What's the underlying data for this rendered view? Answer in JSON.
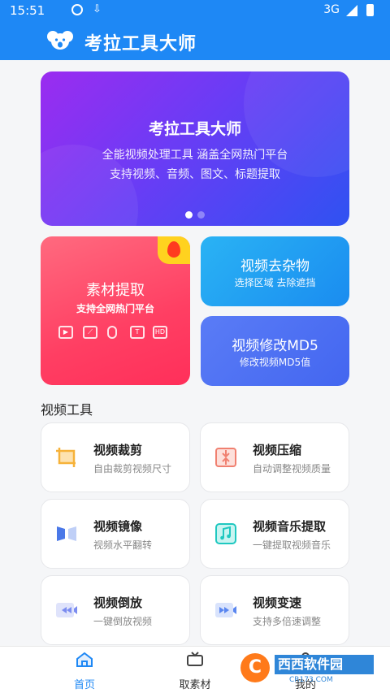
{
  "status_bar": {
    "time": "15:51",
    "network": "3G"
  },
  "app_bar": {
    "title": "考拉工具大师",
    "logo_icon": "koala-icon"
  },
  "banner": {
    "title": "考拉工具大师",
    "subtitle_1": "全能视频处理工具 涵盖全网热门平台",
    "subtitle_2": "支持视频、音频、图文、标题提取"
  },
  "features": {
    "material": {
      "title": "素材提取",
      "subtitle": "支持全网热门平台",
      "badge_icon": "flame-icon",
      "media_icons": [
        "video-icon",
        "image-icon",
        "mic-icon",
        "T",
        "HD"
      ]
    },
    "remove_object": {
      "title": "视频去杂物",
      "subtitle": "选择区域 去除遮挡"
    },
    "md5": {
      "title": "视频修改MD5",
      "subtitle": "修改视频MD5值"
    }
  },
  "tools_section": {
    "title": "视频工具",
    "items": [
      {
        "title": "视频裁剪",
        "subtitle": "自由裁剪视频尺寸",
        "icon": "crop-icon",
        "color": "#f6b23a"
      },
      {
        "title": "视频压缩",
        "subtitle": "自动调整视频质量",
        "icon": "compress-icon",
        "color": "#f08070"
      },
      {
        "title": "视频镜像",
        "subtitle": "视频水平翻转",
        "icon": "mirror-icon",
        "color": "#4a78e8"
      },
      {
        "title": "视频音乐提取",
        "subtitle": "一键提取视频音乐",
        "icon": "music-icon",
        "color": "#1fc8c0"
      },
      {
        "title": "视频倒放",
        "subtitle": "一键倒放视频",
        "icon": "rewind-icon",
        "color": "#7b8cf0"
      },
      {
        "title": "视频变速",
        "subtitle": "支持多倍速调整",
        "icon": "fast-forward-icon",
        "color": "#5a86f0"
      }
    ]
  },
  "bottom_nav": {
    "items": [
      {
        "label": "首页",
        "icon": "home-icon",
        "active": true
      },
      {
        "label": "取素材",
        "icon": "tv-icon",
        "active": false
      },
      {
        "label": "我的",
        "icon": "user-icon",
        "active": false
      }
    ]
  },
  "watermark": {
    "text": "西西软件园",
    "url": "CR173.COM"
  },
  "colors": {
    "primary": "#1e88f5",
    "hot": "#ff3f63"
  }
}
